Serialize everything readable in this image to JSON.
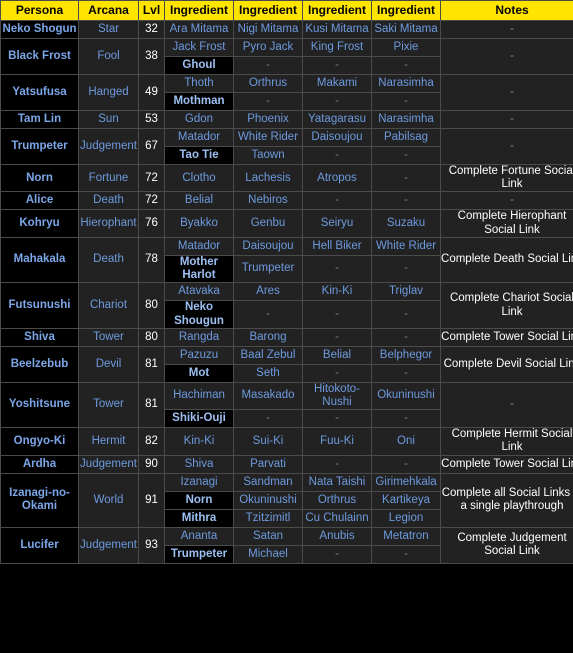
{
  "table": {
    "headers": [
      "Persona",
      "Arcana",
      "Lvl",
      "Ingredient",
      "Ingredient",
      "Ingredient",
      "Ingredient",
      "Notes"
    ],
    "colors": {
      "header_bg": "#ffe400",
      "header_text": "#000000",
      "cell_bg": "#222222",
      "highlight_bg": "#000000",
      "link_text": "#6d9ade",
      "persona_text": "#7ba6e8",
      "notes_text": "#ffffff",
      "border": "#4b4b4b"
    },
    "rows": [
      {
        "persona": "Neko Shogun",
        "arcana": "Star",
        "lvl": "32",
        "notes": "-",
        "notes_dash": true,
        "recipes": [
          {
            "cells": [
              {
                "text": "Ara Mitama",
                "hl": false
              },
              {
                "text": "Nigi Mitama",
                "hl": false
              },
              {
                "text": "Kusi Mitama",
                "hl": false
              },
              {
                "text": "Saki Mitama",
                "hl": false
              }
            ]
          }
        ]
      },
      {
        "persona": "Black Frost",
        "arcana": "Fool",
        "lvl": "38",
        "notes": "-",
        "notes_dash": true,
        "recipes": [
          {
            "cells": [
              {
                "text": "Jack Frost",
                "hl": false
              },
              {
                "text": "Pyro Jack",
                "hl": false
              },
              {
                "text": "King Frost",
                "hl": false
              },
              {
                "text": "Pixie",
                "hl": false
              }
            ]
          },
          {
            "cells": [
              {
                "text": "Ghoul",
                "hl": true
              },
              {
                "text": "-",
                "hl": false
              },
              {
                "text": "-",
                "hl": false
              },
              {
                "text": "-",
                "hl": false
              }
            ]
          }
        ]
      },
      {
        "persona": "Yatsufusa",
        "arcana": "Hanged",
        "lvl": "49",
        "notes": "-",
        "notes_dash": true,
        "recipes": [
          {
            "cells": [
              {
                "text": "Thoth",
                "hl": false
              },
              {
                "text": "Orthrus",
                "hl": false
              },
              {
                "text": "Makami",
                "hl": false
              },
              {
                "text": "Narasimha",
                "hl": false
              }
            ]
          },
          {
            "cells": [
              {
                "text": "Mothman",
                "hl": true
              },
              {
                "text": "-",
                "hl": false
              },
              {
                "text": "-",
                "hl": false
              },
              {
                "text": "-",
                "hl": false
              }
            ]
          }
        ]
      },
      {
        "persona": "Tam Lin",
        "arcana": "Sun",
        "lvl": "53",
        "notes": "-",
        "notes_dash": true,
        "recipes": [
          {
            "cells": [
              {
                "text": "Gdon",
                "hl": false
              },
              {
                "text": "Phoenix",
                "hl": false
              },
              {
                "text": "Yatagarasu",
                "hl": false
              },
              {
                "text": "Narasimha",
                "hl": false
              }
            ]
          }
        ]
      },
      {
        "persona": "Trumpeter",
        "arcana": "Judgement",
        "lvl": "67",
        "notes": "-",
        "notes_dash": true,
        "recipes": [
          {
            "cells": [
              {
                "text": "Matador",
                "hl": false
              },
              {
                "text": "White Rider",
                "hl": false
              },
              {
                "text": "Daisoujou",
                "hl": false
              },
              {
                "text": "Pabilsag",
                "hl": false
              }
            ]
          },
          {
            "cells": [
              {
                "text": "Tao Tie",
                "hl": true
              },
              {
                "text": "Taown",
                "hl": false
              },
              {
                "text": "-",
                "hl": false
              },
              {
                "text": "-",
                "hl": false
              }
            ]
          }
        ]
      },
      {
        "persona": "Norn",
        "arcana": "Fortune",
        "lvl": "72",
        "notes": "Complete Fortune Social Link",
        "notes_dash": false,
        "recipes": [
          {
            "cells": [
              {
                "text": "Clotho",
                "hl": false
              },
              {
                "text": "Lachesis",
                "hl": false
              },
              {
                "text": "Atropos",
                "hl": false
              },
              {
                "text": "-",
                "hl": false
              }
            ]
          }
        ]
      },
      {
        "persona": "Alice",
        "arcana": "Death",
        "lvl": "72",
        "notes": "-",
        "notes_dash": true,
        "recipes": [
          {
            "cells": [
              {
                "text": "Belial",
                "hl": false
              },
              {
                "text": "Nebiros",
                "hl": false
              },
              {
                "text": "-",
                "hl": false
              },
              {
                "text": "-",
                "hl": false
              }
            ]
          }
        ]
      },
      {
        "persona": "Kohryu",
        "arcana": "Hierophant",
        "lvl": "76",
        "notes": "Complete Hierophant Social Link",
        "notes_dash": false,
        "recipes": [
          {
            "cells": [
              {
                "text": "Byakko",
                "hl": false
              },
              {
                "text": "Genbu",
                "hl": false
              },
              {
                "text": "Seiryu",
                "hl": false
              },
              {
                "text": "Suzaku",
                "hl": false
              }
            ]
          }
        ]
      },
      {
        "persona": "Mahakala",
        "arcana": "Death",
        "lvl": "78",
        "notes": "Complete Death Social Link",
        "notes_dash": false,
        "recipes": [
          {
            "cells": [
              {
                "text": "Matador",
                "hl": false
              },
              {
                "text": "Daisoujou",
                "hl": false
              },
              {
                "text": "Hell Biker",
                "hl": false
              },
              {
                "text": "White Rider",
                "hl": false
              }
            ]
          },
          {
            "cells": [
              {
                "text": "Mother Harlot",
                "hl": true
              },
              {
                "text": "Trumpeter",
                "hl": false
              },
              {
                "text": "-",
                "hl": false
              },
              {
                "text": "-",
                "hl": false
              }
            ]
          }
        ]
      },
      {
        "persona": "Futsunushi",
        "arcana": "Chariot",
        "lvl": "80",
        "notes": "Complete Chariot Social Link",
        "notes_dash": false,
        "recipes": [
          {
            "cells": [
              {
                "text": "Atavaka",
                "hl": false
              },
              {
                "text": "Ares",
                "hl": false
              },
              {
                "text": "Kin-Ki",
                "hl": false
              },
              {
                "text": "Triglav",
                "hl": false
              }
            ]
          },
          {
            "cells": [
              {
                "text": "Neko Shougun",
                "hl": true
              },
              {
                "text": "-",
                "hl": false
              },
              {
                "text": "-",
                "hl": false
              },
              {
                "text": "-",
                "hl": false
              }
            ]
          }
        ]
      },
      {
        "persona": "Shiva",
        "arcana": "Tower",
        "lvl": "80",
        "notes": "Complete Tower Social Link",
        "notes_dash": false,
        "recipes": [
          {
            "cells": [
              {
                "text": "Rangda",
                "hl": false
              },
              {
                "text": "Barong",
                "hl": false
              },
              {
                "text": "-",
                "hl": false
              },
              {
                "text": "-",
                "hl": false
              }
            ]
          }
        ]
      },
      {
        "persona": "Beelzebub",
        "arcana": "Devil",
        "lvl": "81",
        "notes": "Complete Devil Social Link",
        "notes_dash": false,
        "recipes": [
          {
            "cells": [
              {
                "text": "Pazuzu",
                "hl": false
              },
              {
                "text": "Baal Zebul",
                "hl": false
              },
              {
                "text": "Belial",
                "hl": false
              },
              {
                "text": "Belphegor",
                "hl": false
              }
            ]
          },
          {
            "cells": [
              {
                "text": "Mot",
                "hl": true
              },
              {
                "text": "Seth",
                "hl": false
              },
              {
                "text": "-",
                "hl": false
              },
              {
                "text": "-",
                "hl": false
              }
            ]
          }
        ]
      },
      {
        "persona": "Yoshitsune",
        "arcana": "Tower",
        "lvl": "81",
        "notes": "-",
        "notes_dash": true,
        "recipes": [
          {
            "cells": [
              {
                "text": "Hachiman",
                "hl": false
              },
              {
                "text": "Masakado",
                "hl": false
              },
              {
                "text": "Hitokoto-Nushi",
                "hl": false
              },
              {
                "text": "Okuninushi",
                "hl": false
              }
            ]
          },
          {
            "cells": [
              {
                "text": "Shiki-Ouji",
                "hl": true
              },
              {
                "text": "-",
                "hl": false
              },
              {
                "text": "-",
                "hl": false
              },
              {
                "text": "-",
                "hl": false
              }
            ]
          }
        ]
      },
      {
        "persona": "Ongyo-Ki",
        "arcana": "Hermit",
        "lvl": "82",
        "notes": "Complete Hermit Social Link",
        "notes_dash": false,
        "recipes": [
          {
            "cells": [
              {
                "text": "Kin-Ki",
                "hl": false
              },
              {
                "text": "Sui-Ki",
                "hl": false
              },
              {
                "text": "Fuu-Ki",
                "hl": false
              },
              {
                "text": "Oni",
                "hl": false
              }
            ]
          }
        ]
      },
      {
        "persona": "Ardha",
        "arcana": "Judgement",
        "lvl": "90",
        "notes": "Complete Tower Social Link",
        "notes_dash": false,
        "recipes": [
          {
            "cells": [
              {
                "text": "Shiva",
                "hl": false
              },
              {
                "text": "Parvati",
                "hl": false
              },
              {
                "text": "-",
                "hl": false
              },
              {
                "text": "-",
                "hl": false
              }
            ]
          }
        ]
      },
      {
        "persona": "Izanagi-no-Okami",
        "arcana": "World",
        "lvl": "91",
        "notes": "Complete all Social Links in a single playthrough",
        "notes_dash": false,
        "recipes": [
          {
            "cells": [
              {
                "text": "Izanagi",
                "hl": false
              },
              {
                "text": "Sandman",
                "hl": false
              },
              {
                "text": "Nata Taishi",
                "hl": false
              },
              {
                "text": "Girimehkala",
                "hl": false
              }
            ]
          },
          {
            "cells": [
              {
                "text": "Norn",
                "hl": true
              },
              {
                "text": "Okuninushi",
                "hl": false
              },
              {
                "text": "Orthrus",
                "hl": false
              },
              {
                "text": "Kartikeya",
                "hl": false
              }
            ]
          },
          {
            "cells": [
              {
                "text": "Mithra",
                "hl": true
              },
              {
                "text": "Tzitzimitl",
                "hl": false
              },
              {
                "text": "Cu Chulainn",
                "hl": false
              },
              {
                "text": "Legion",
                "hl": false
              }
            ]
          }
        ]
      },
      {
        "persona": "Lucifer",
        "arcana": "Judgement",
        "lvl": "93",
        "notes": "Complete Judgement Social Link",
        "notes_dash": false,
        "recipes": [
          {
            "cells": [
              {
                "text": "Ananta",
                "hl": false
              },
              {
                "text": "Satan",
                "hl": false
              },
              {
                "text": "Anubis",
                "hl": false
              },
              {
                "text": "Metatron",
                "hl": false
              }
            ]
          },
          {
            "cells": [
              {
                "text": "Trumpeter",
                "hl": true
              },
              {
                "text": "Michael",
                "hl": false
              },
              {
                "text": "-",
                "hl": false
              },
              {
                "text": "-",
                "hl": false
              }
            ]
          }
        ]
      }
    ]
  }
}
